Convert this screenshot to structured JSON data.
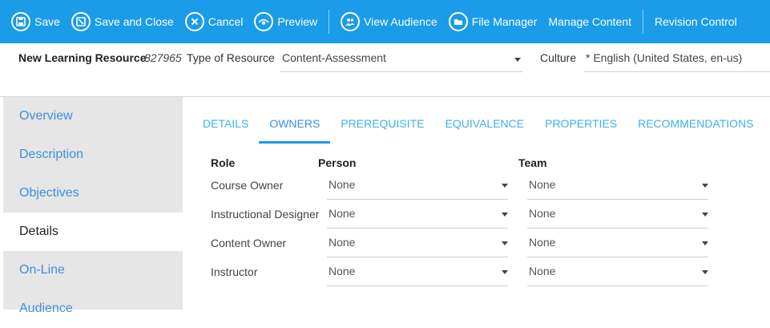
{
  "toolbar": {
    "save": "Save",
    "save_close": "Save and Close",
    "cancel": "Cancel",
    "preview": "Preview",
    "view_audience": "View Audience",
    "file_manager": "File Manager",
    "manage_content": "Manage Content",
    "revision_control": "Revision Control",
    "background_color": "#1a9ce8"
  },
  "header": {
    "title": "New Learning Resource",
    "resource_id": "827965",
    "type_label": "Type of Resource",
    "type_value": "Content-Assessment",
    "culture_label": "Culture",
    "culture_value": "* English (United States, en-us)"
  },
  "sidebar": {
    "items": [
      {
        "label": "Overview"
      },
      {
        "label": "Description"
      },
      {
        "label": "Objectives"
      },
      {
        "label": "Details"
      },
      {
        "label": "On-Line"
      },
      {
        "label": "Audience"
      }
    ],
    "active": "Details"
  },
  "tabs": {
    "items": [
      {
        "label": "DETAILS"
      },
      {
        "label": "OWNERS"
      },
      {
        "label": "PREREQUISITE"
      },
      {
        "label": "EQUIVALENCE"
      },
      {
        "label": "PROPERTIES"
      },
      {
        "label": "RECOMMENDATIONS"
      }
    ],
    "active": "OWNERS"
  },
  "owners": {
    "headers": {
      "role": "Role",
      "person": "Person",
      "team": "Team"
    },
    "rows": [
      {
        "role": "Course Owner",
        "person": "None",
        "team": "None"
      },
      {
        "role": "Instructional Designer",
        "person": "None",
        "team": "None"
      },
      {
        "role": "Content Owner",
        "person": "None",
        "team": "None"
      },
      {
        "role": "Instructor",
        "person": "None",
        "team": "None"
      }
    ]
  }
}
